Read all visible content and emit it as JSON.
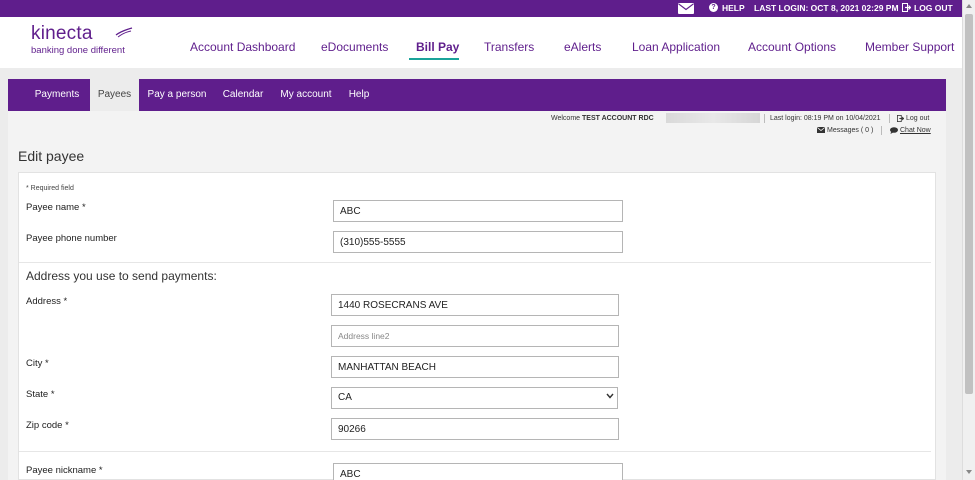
{
  "util_bar": {
    "mail_icon": "envelope-icon",
    "help_label": "HELP",
    "last_login": "LAST LOGIN: OCT 8, 2021 02:29 PM",
    "logout_label": "LOG OUT"
  },
  "brand": {
    "name": "kinecta",
    "tagline": "banking done different",
    "color": "#5f1e8c",
    "accent": "#1aa39a"
  },
  "main_nav": [
    {
      "label": "Account Dashboard"
    },
    {
      "label": "eDocuments"
    },
    {
      "label": "Bill Pay",
      "active": true
    },
    {
      "label": "Transfers"
    },
    {
      "label": "eAlerts"
    },
    {
      "label": "Loan Application"
    },
    {
      "label": "Account Options"
    },
    {
      "label": "Member Support"
    }
  ],
  "sub_nav": [
    {
      "label": "Payments"
    },
    {
      "label": "Payees",
      "active": true
    },
    {
      "label": "Pay a person"
    },
    {
      "label": "Calendar"
    },
    {
      "label": "My account"
    },
    {
      "label": "Help"
    }
  ],
  "session": {
    "welcome_prefix": "Welcome",
    "account_name": "TEST ACCOUNT RDC",
    "last_login": "Last login: 08:19 PM on 10/04/2021",
    "log_out": "Log out",
    "messages": "Messages ( 0 )",
    "chat_now": "Chat Now"
  },
  "page": {
    "title": "Edit payee",
    "required_note": "* Required field"
  },
  "form": {
    "payee_name": {
      "label": "Payee name *",
      "value": "ABC"
    },
    "payee_phone": {
      "label": "Payee phone number",
      "value": "(310)555-5555"
    },
    "address_section": "Address you use to send payments:",
    "address": {
      "label": "Address *",
      "value": "1440 ROSECRANS AVE"
    },
    "address2": {
      "placeholder": "Address line2"
    },
    "city": {
      "label": "City *",
      "value": "MANHATTAN BEACH"
    },
    "state": {
      "label": "State *",
      "value": "CA"
    },
    "zip": {
      "label": "Zip code *",
      "value": "90266"
    },
    "nickname": {
      "label": "Payee nickname *",
      "value": "ABC"
    }
  }
}
